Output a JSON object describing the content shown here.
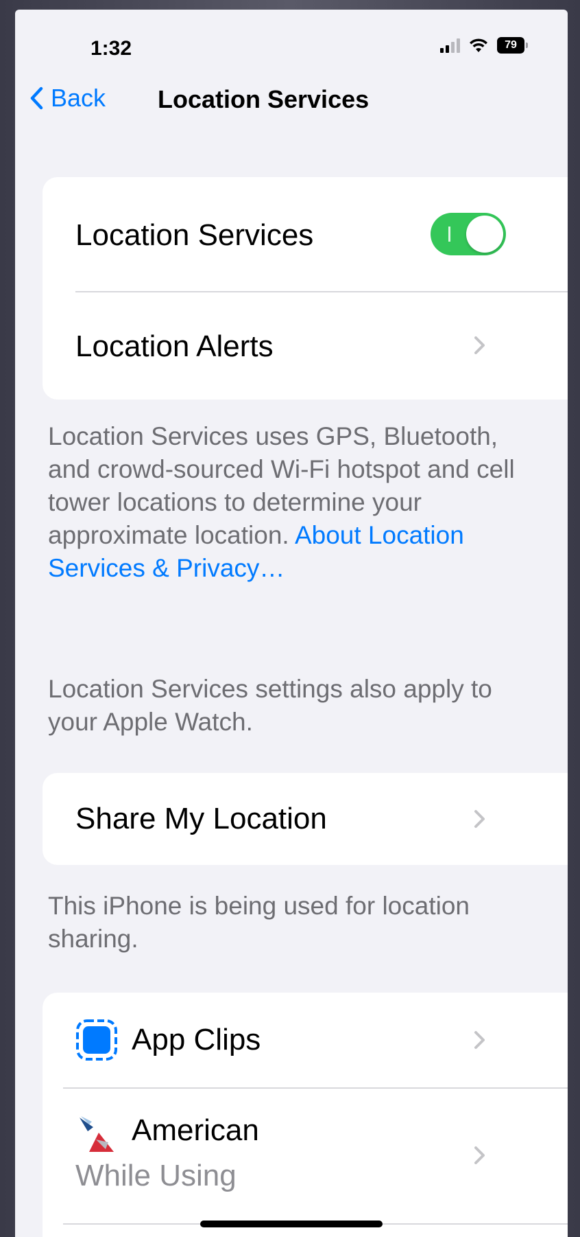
{
  "status_bar": {
    "time": "1:32",
    "battery": "79"
  },
  "nav": {
    "back_label": "Back",
    "title": "Location Services"
  },
  "group_main": {
    "location_services_label": "Location Services",
    "location_services_enabled": true,
    "location_alerts_label": "Location Alerts"
  },
  "footnote_main": {
    "text": "Location Services uses GPS, Bluetooth, and crowd-sourced Wi-Fi hotspot and cell tower locations to determine your approximate location.",
    "link": "About Location Services & Privacy…"
  },
  "footnote_watch": {
    "text": "Location Services settings also apply to your Apple Watch."
  },
  "share": {
    "label": "Share My Location",
    "footnote": "This iPhone is being used for location sharing."
  },
  "apps": {
    "items": [
      {
        "name": "App Clips",
        "icon": "app-clips-icon"
      },
      {
        "name": "American",
        "icon": "american-airlines-icon",
        "permission": "While Using"
      }
    ]
  },
  "colors": {
    "accent": "#007aff",
    "toggle_on": "#34c759",
    "background": "#f2f2f7"
  }
}
